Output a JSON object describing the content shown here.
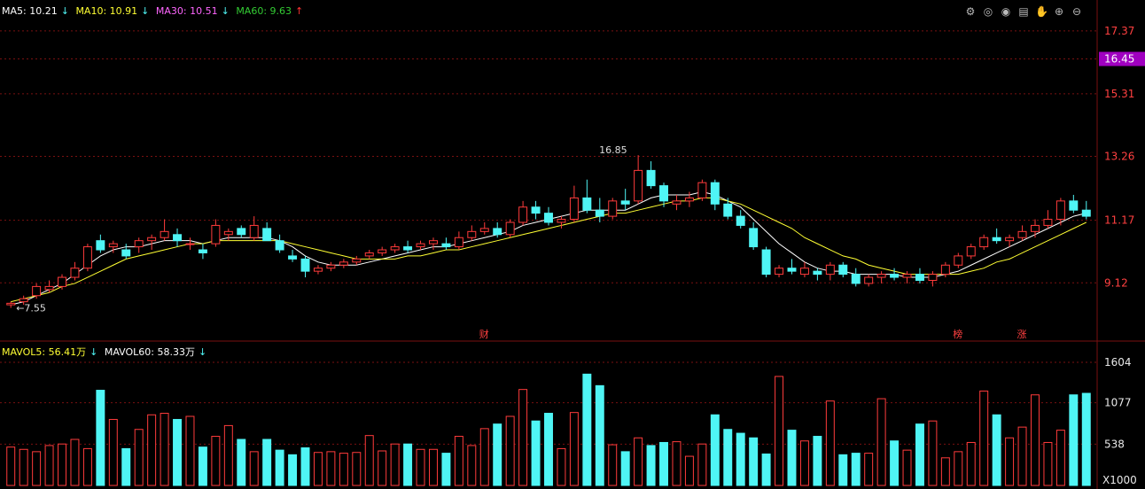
{
  "legend_top": [
    {
      "label": "MA5: 10.21",
      "arrow": "↓",
      "color": "#ffffff"
    },
    {
      "label": "MA10: 10.91",
      "arrow": "↓",
      "color": "#ffff33"
    },
    {
      "label": "MA30: 10.51",
      "arrow": "↓",
      "color": "#ff66ff"
    },
    {
      "label": "MA60: 9.63",
      "arrow": "↑",
      "color": "#33cc33"
    }
  ],
  "legend_vol": [
    {
      "label": "MAVOL5: 56.41万",
      "arrow": "↓",
      "color": "#ffff33"
    },
    {
      "label": "MAVOL60: 58.33万",
      "arrow": "↓",
      "color": "#ffffff"
    }
  ],
  "toolbar_icons": [
    "settings-icon",
    "eye-icon",
    "eye-open-icon",
    "bag-icon",
    "hand-icon",
    "zoom-in-icon",
    "zoom-out-icon"
  ],
  "toolbar_glyphs": [
    "⚙",
    "◎",
    "◉",
    "▤",
    "✋",
    "⊕",
    "⊖"
  ],
  "colors": {
    "up": "#ff3b3b",
    "down": "#4ff5f5",
    "grid": "#7a1010",
    "axis_text": "#e8e8e8",
    "price_tag": "#a000c0"
  },
  "price_axis": {
    "ticks": [
      "17.37",
      "16.45",
      "15.31",
      "13.26",
      "11.17",
      "9.12"
    ],
    "current": "16.45"
  },
  "vol_axis": {
    "ticks": [
      "1604",
      "1077",
      "538"
    ],
    "unit": "X1000"
  },
  "annotations": {
    "high": "16.85",
    "low": "7.55",
    "markers": [
      "财",
      "榜",
      "涨"
    ]
  },
  "chart_data": {
    "type": "candlestick",
    "price_range": [
      7.3,
      17.8
    ],
    "volume_range": [
      0,
      1650
    ],
    "candles": [
      [
        8.4,
        8.5,
        8.3,
        8.45,
        500
      ],
      [
        8.5,
        8.7,
        8.4,
        8.6,
        470
      ],
      [
        8.7,
        9.1,
        8.6,
        9.0,
        440
      ],
      [
        8.9,
        9.2,
        8.8,
        9.0,
        520
      ],
      [
        9.0,
        9.4,
        8.9,
        9.3,
        540
      ],
      [
        9.3,
        9.8,
        9.2,
        9.6,
        600
      ],
      [
        9.6,
        10.4,
        9.5,
        10.3,
        480
      ],
      [
        10.5,
        10.7,
        10.1,
        10.2,
        1240
      ],
      [
        10.3,
        10.5,
        10.1,
        10.4,
        860
      ],
      [
        10.2,
        10.4,
        9.9,
        10.0,
        480
      ],
      [
        10.3,
        10.6,
        10.1,
        10.5,
        730
      ],
      [
        10.5,
        10.7,
        10.2,
        10.6,
        920
      ],
      [
        10.6,
        11.2,
        10.5,
        10.8,
        940
      ],
      [
        10.7,
        10.9,
        10.3,
        10.5,
        860
      ],
      [
        10.4,
        10.6,
        10.2,
        10.4,
        900
      ],
      [
        10.2,
        10.4,
        9.9,
        10.1,
        500
      ],
      [
        10.4,
        11.2,
        10.3,
        11.0,
        640
      ],
      [
        10.7,
        10.9,
        10.5,
        10.8,
        780
      ],
      [
        10.9,
        11.0,
        10.6,
        10.7,
        600
      ],
      [
        10.6,
        11.3,
        10.5,
        11.0,
        440
      ],
      [
        10.9,
        11.1,
        10.5,
        10.5,
        600
      ],
      [
        10.5,
        10.7,
        10.1,
        10.2,
        460
      ],
      [
        10.0,
        10.2,
        9.8,
        9.9,
        400
      ],
      [
        9.9,
        10.0,
        9.3,
        9.5,
        490
      ],
      [
        9.5,
        9.7,
        9.4,
        9.6,
        430
      ],
      [
        9.6,
        9.8,
        9.5,
        9.7,
        440
      ],
      [
        9.7,
        9.9,
        9.6,
        9.8,
        420
      ],
      [
        9.8,
        10.0,
        9.7,
        9.9,
        430
      ],
      [
        10.0,
        10.2,
        9.9,
        10.1,
        650
      ],
      [
        10.1,
        10.3,
        10.0,
        10.2,
        450
      ],
      [
        10.2,
        10.4,
        10.1,
        10.3,
        540
      ],
      [
        10.3,
        10.5,
        10.1,
        10.2,
        540
      ],
      [
        10.3,
        10.5,
        10.2,
        10.4,
        470
      ],
      [
        10.4,
        10.6,
        10.2,
        10.5,
        470
      ],
      [
        10.4,
        10.6,
        10.2,
        10.3,
        420
      ],
      [
        10.3,
        10.8,
        10.2,
        10.6,
        640
      ],
      [
        10.6,
        11.0,
        10.5,
        10.8,
        520
      ],
      [
        10.8,
        11.1,
        10.7,
        10.9,
        740
      ],
      [
        10.9,
        11.1,
        10.6,
        10.7,
        800
      ],
      [
        10.7,
        11.2,
        10.6,
        11.1,
        900
      ],
      [
        11.1,
        11.8,
        11.0,
        11.6,
        1250
      ],
      [
        11.6,
        11.8,
        11.2,
        11.4,
        840
      ],
      [
        11.4,
        11.6,
        11.0,
        11.1,
        940
      ],
      [
        11.1,
        11.3,
        10.9,
        11.2,
        480
      ],
      [
        11.2,
        12.3,
        11.1,
        11.9,
        950
      ],
      [
        11.9,
        12.5,
        11.4,
        11.5,
        1450
      ],
      [
        11.5,
        11.9,
        11.1,
        11.3,
        1300
      ],
      [
        11.3,
        11.9,
        11.2,
        11.8,
        530
      ],
      [
        11.8,
        12.2,
        11.5,
        11.7,
        440
      ],
      [
        11.8,
        13.3,
        11.7,
        12.8,
        620
      ],
      [
        12.8,
        13.1,
        12.2,
        12.3,
        520
      ],
      [
        12.3,
        12.4,
        11.6,
        11.8,
        560
      ],
      [
        11.7,
        12.0,
        11.5,
        11.8,
        570
      ],
      [
        11.8,
        12.1,
        11.6,
        11.9,
        380
      ],
      [
        11.9,
        12.5,
        11.8,
        12.4,
        540
      ],
      [
        12.4,
        12.5,
        11.5,
        11.7,
        920
      ],
      [
        11.7,
        11.9,
        11.2,
        11.3,
        730
      ],
      [
        11.3,
        11.5,
        10.9,
        11.0,
        680
      ],
      [
        10.9,
        11.1,
        10.2,
        10.3,
        620
      ],
      [
        10.2,
        10.3,
        9.3,
        9.4,
        410
      ],
      [
        9.4,
        9.7,
        9.3,
        9.6,
        1420
      ],
      [
        9.6,
        9.9,
        9.4,
        9.5,
        720
      ],
      [
        9.4,
        9.8,
        9.3,
        9.6,
        580
      ],
      [
        9.5,
        9.6,
        9.2,
        9.4,
        640
      ],
      [
        9.4,
        9.8,
        9.2,
        9.7,
        1100
      ],
      [
        9.7,
        9.8,
        9.3,
        9.4,
        400
      ],
      [
        9.4,
        9.6,
        9.0,
        9.1,
        420
      ],
      [
        9.1,
        9.4,
        9.0,
        9.3,
        420
      ],
      [
        9.3,
        9.5,
        9.1,
        9.4,
        1130
      ],
      [
        9.4,
        9.6,
        9.2,
        9.3,
        580
      ],
      [
        9.3,
        9.5,
        9.1,
        9.4,
        460
      ],
      [
        9.4,
        9.6,
        9.1,
        9.2,
        800
      ],
      [
        9.2,
        9.5,
        9.0,
        9.4,
        840
      ],
      [
        9.4,
        9.8,
        9.3,
        9.7,
        360
      ],
      [
        9.7,
        10.1,
        9.6,
        10.0,
        440
      ],
      [
        10.0,
        10.4,
        9.9,
        10.3,
        560
      ],
      [
        10.3,
        10.7,
        10.2,
        10.6,
        1230
      ],
      [
        10.6,
        10.9,
        10.4,
        10.5,
        920
      ],
      [
        10.5,
        10.7,
        10.3,
        10.6,
        620
      ],
      [
        10.6,
        11.0,
        10.5,
        10.8,
        760
      ],
      [
        10.8,
        11.2,
        10.6,
        11.0,
        1180
      ],
      [
        11.0,
        11.5,
        10.9,
        11.2,
        560
      ],
      [
        11.2,
        11.9,
        11.0,
        11.8,
        720
      ],
      [
        11.8,
        12.0,
        11.4,
        11.5,
        1180
      ],
      [
        11.5,
        11.8,
        11.2,
        11.3,
        1200
      ]
    ],
    "ma5": [
      8.4,
      8.5,
      8.7,
      8.9,
      9.1,
      9.4,
      9.7,
      10.0,
      10.2,
      10.3,
      10.3,
      10.4,
      10.5,
      10.5,
      10.5,
      10.4,
      10.5,
      10.6,
      10.6,
      10.6,
      10.6,
      10.5,
      10.3,
      10.0,
      9.8,
      9.7,
      9.7,
      9.7,
      9.8,
      9.9,
      10.0,
      10.1,
      10.2,
      10.3,
      10.3,
      10.4,
      10.5,
      10.6,
      10.7,
      10.8,
      11.0,
      11.1,
      11.2,
      11.3,
      11.4,
      11.5,
      11.5,
      11.5,
      11.5,
      11.7,
      11.9,
      12.0,
      12.0,
      12.0,
      12.1,
      12.0,
      11.8,
      11.6,
      11.2,
      10.8,
      10.4,
      10.1,
      9.8,
      9.6,
      9.5,
      9.5,
      9.4,
      9.4,
      9.4,
      9.4,
      9.3,
      9.3,
      9.3,
      9.4,
      9.5,
      9.7,
      9.9,
      10.1,
      10.3,
      10.5,
      10.7,
      10.9,
      11.1,
      11.3,
      11.4
    ],
    "ma10": [
      8.5,
      8.6,
      8.7,
      8.8,
      9.0,
      9.1,
      9.3,
      9.5,
      9.7,
      9.9,
      10.0,
      10.1,
      10.2,
      10.3,
      10.4,
      10.4,
      10.5,
      10.5,
      10.5,
      10.5,
      10.5,
      10.5,
      10.4,
      10.3,
      10.2,
      10.1,
      10.0,
      9.9,
      9.9,
      9.9,
      9.9,
      10.0,
      10.0,
      10.1,
      10.2,
      10.2,
      10.3,
      10.4,
      10.5,
      10.6,
      10.7,
      10.8,
      10.9,
      11.0,
      11.1,
      11.2,
      11.3,
      11.4,
      11.4,
      11.5,
      11.6,
      11.7,
      11.8,
      11.8,
      11.9,
      11.9,
      11.8,
      11.7,
      11.5,
      11.3,
      11.1,
      10.9,
      10.6,
      10.4,
      10.2,
      10.0,
      9.9,
      9.7,
      9.6,
      9.5,
      9.4,
      9.4,
      9.4,
      9.4,
      9.4,
      9.5,
      9.6,
      9.8,
      9.9,
      10.1,
      10.3,
      10.5,
      10.7,
      10.9,
      11.1
    ]
  }
}
